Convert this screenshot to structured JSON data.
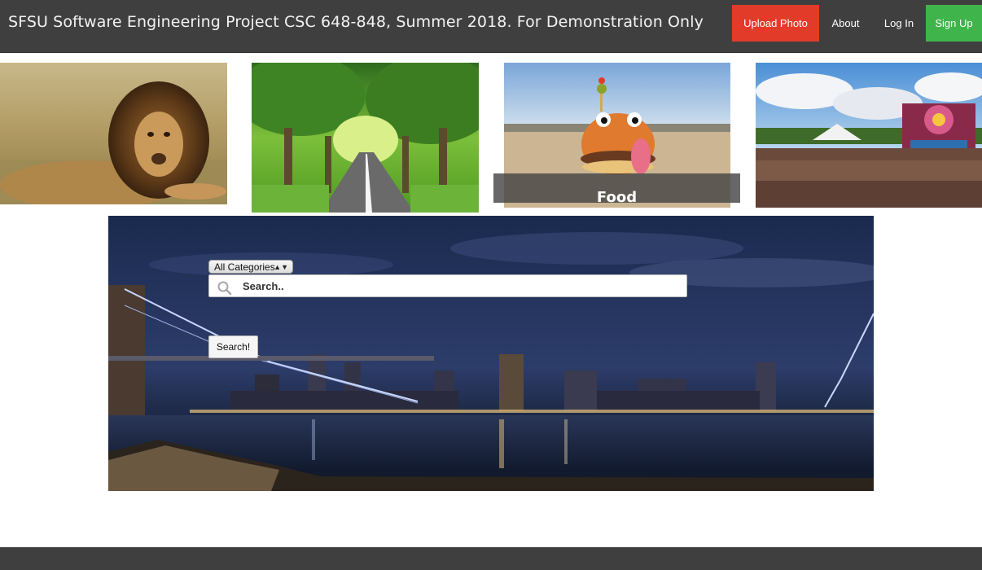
{
  "header": {
    "title": "SFSU Software Engineering Project CSC 648-848, Summer 2018. For Demonstration Only",
    "nav": {
      "upload": "Upload Photo",
      "about": "About",
      "login": "Log In",
      "signup": "Sign Up"
    }
  },
  "gallery": {
    "tiles": [
      {
        "name": "lion-photo",
        "caption": ""
      },
      {
        "name": "tree-road-photo",
        "caption": ""
      },
      {
        "name": "burger-character-photo",
        "caption": "Food"
      },
      {
        "name": "festival-crowd-photo",
        "caption": ""
      }
    ]
  },
  "search": {
    "category": "All Categories",
    "placeholder": "Search..",
    "button": "Search!"
  },
  "colors": {
    "header_bg": "#3f3f3f",
    "upload_bg": "#e23b2a",
    "signup_bg": "#3fb44a",
    "footer_bg": "#3f3f3f"
  }
}
